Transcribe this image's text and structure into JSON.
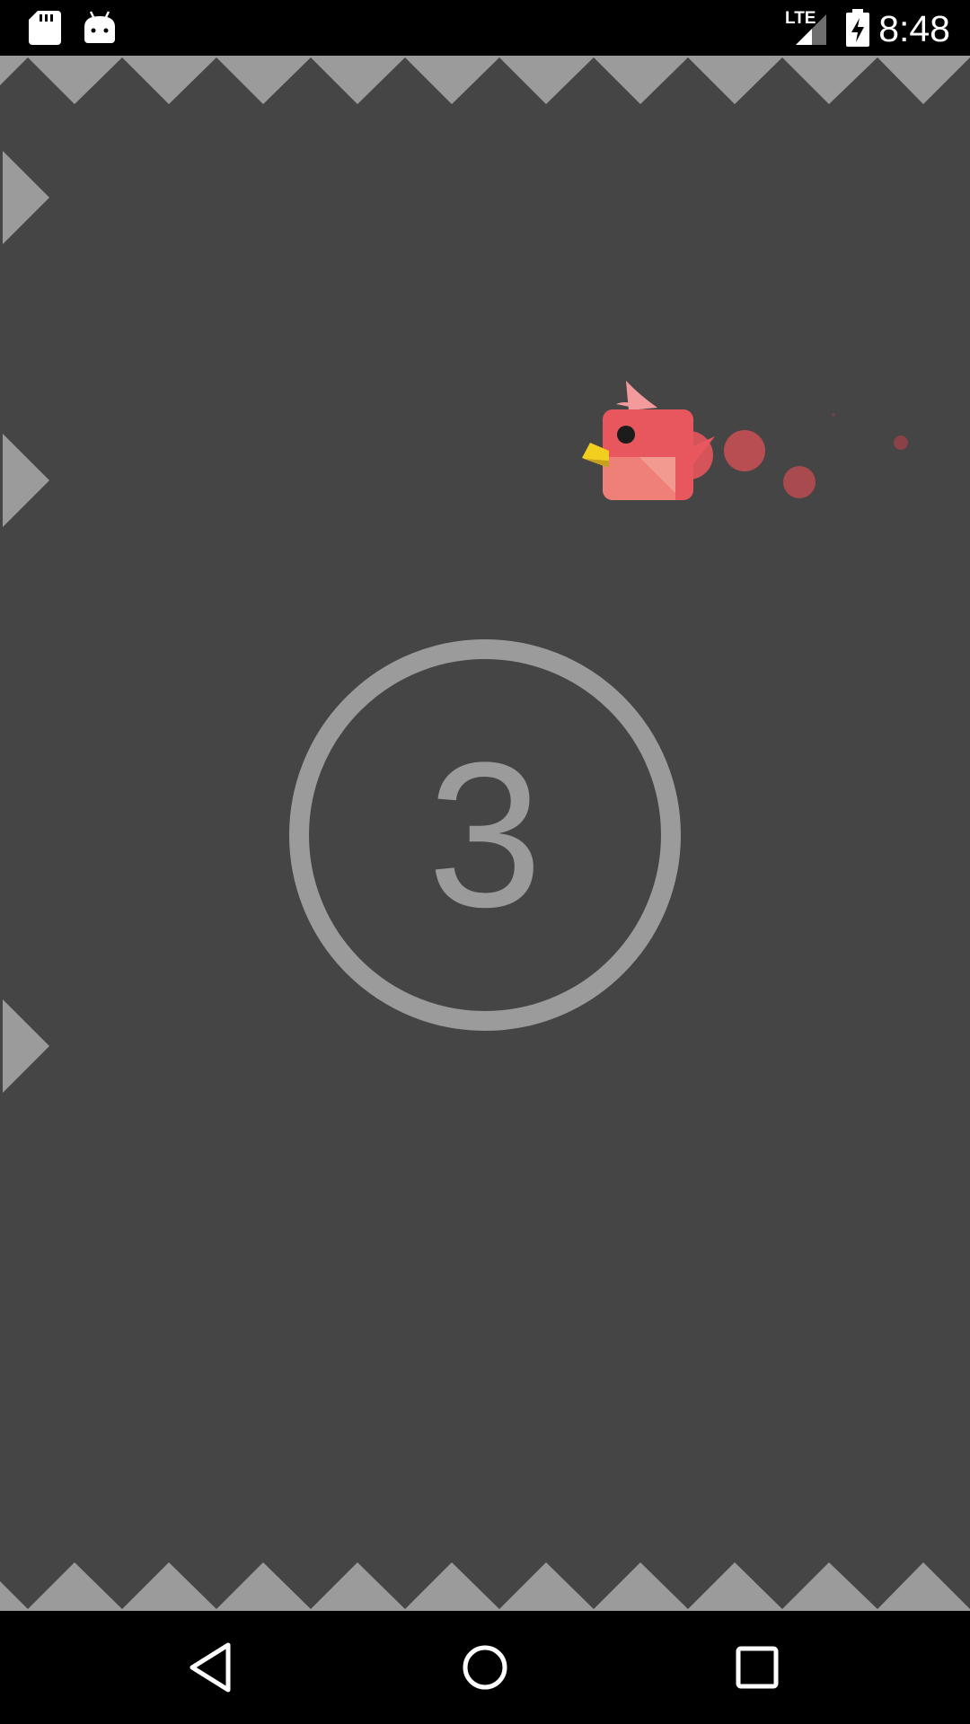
{
  "status_bar": {
    "time": "8:48",
    "network_label": "LTE",
    "icons": [
      "sd-card-icon",
      "android-icon",
      "lte-signal-icon",
      "battery-charging-icon"
    ]
  },
  "game": {
    "countdown": "3",
    "colors": {
      "background": "#454545",
      "spikes": "#9b9b9b",
      "bird_body": "#e8575e",
      "bird_beak": "#f2cf1f"
    }
  },
  "nav_bar": {
    "icons": [
      "back-icon",
      "home-icon",
      "recents-icon"
    ]
  }
}
